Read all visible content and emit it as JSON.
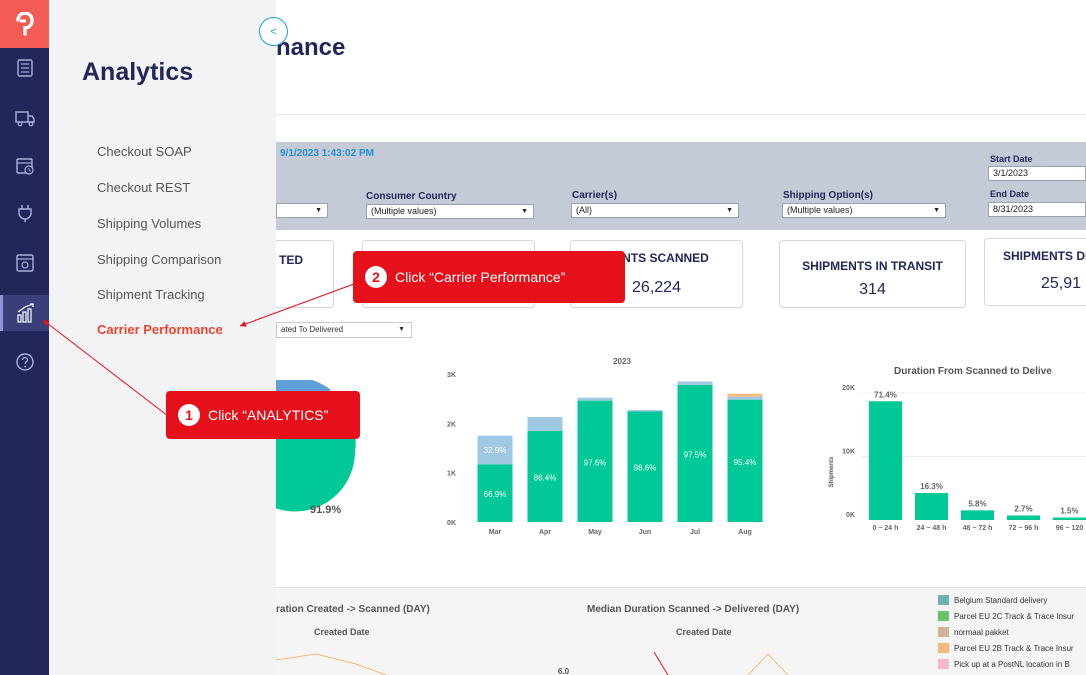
{
  "flyout": {
    "title": "Analytics",
    "items": [
      {
        "label": "Checkout SOAP"
      },
      {
        "label": "Checkout REST"
      },
      {
        "label": "Shipping Volumes"
      },
      {
        "label": "Shipping Comparison"
      },
      {
        "label": "Shipment Tracking"
      },
      {
        "label": "Carrier Performance"
      }
    ],
    "active_index": 5
  },
  "page": {
    "title_partial": "nance",
    "collapse_glyph": "<"
  },
  "filters": {
    "timestamp": "9/1/2023 1:43:02 PM",
    "consumer_country": {
      "label": "Consumer Country",
      "value": "(Multiple values)"
    },
    "carriers": {
      "label": "Carrier(s)",
      "value": "(All)"
    },
    "shipping_option": {
      "label": "Shipping Option(s)",
      "value": "(Multiple values)"
    },
    "start_date": {
      "label": "Start Date",
      "value": "3/1/2023"
    },
    "end_date": {
      "label": "End Date",
      "value": "8/31/2023"
    }
  },
  "kpis": [
    {
      "title": "TED",
      "value": ""
    },
    {
      "title": "MENTS SCANNED",
      "value": "26,224"
    },
    {
      "title": "SHIPMENTS IN TRANSIT",
      "value": "314"
    },
    {
      "title": "SHIPMENTS DE",
      "value": "25,91"
    }
  ],
  "duration_dropdown": {
    "value": "ated To Delivered"
  },
  "pie": {
    "label": "91.9%"
  },
  "chart_data": [
    {
      "type": "bar",
      "title": "2023",
      "categories": [
        "Mar",
        "Apr",
        "May",
        "Jun",
        "Jul",
        "Aug"
      ],
      "yticks": [
        "0K",
        "1K",
        "2K",
        "3K"
      ],
      "ylim": [
        0,
        3000
      ],
      "series": [
        {
          "values": [
            1170,
            1850,
            2460,
            2240,
            2780,
            2480
          ]
        },
        {
          "values": [
            580,
            280,
            60,
            30,
            70,
            60
          ]
        },
        {
          "values": [
            0,
            0,
            0,
            0,
            0,
            60
          ]
        }
      ],
      "labels": [
        "66.9%",
        "86.4%",
        "97.6%",
        "98.6%",
        "97.5%",
        "95.4%"
      ],
      "extra_label": "32.9%",
      "colors": [
        "#00c896",
        "#9fc8e3",
        "#f5b97a"
      ]
    },
    {
      "type": "bar",
      "title": "Duration From Scanned to Delive",
      "ylabel": "Shipments",
      "categories": [
        "0 ~ 24 h",
        "24 ~ 48 h",
        "48 ~ 72 h",
        "72 ~ 96 h",
        "96 ~ 120"
      ],
      "values": [
        18700,
        4250,
        1520,
        710,
        390
      ],
      "labels": [
        "71.4%",
        "16.3%",
        "5.8%",
        "2.7%",
        "1.5%"
      ],
      "yticks": [
        "0K",
        "10K",
        "20K"
      ],
      "ylim": [
        0,
        20000
      ],
      "color": "#00c896"
    }
  ],
  "lower": {
    "title_left": "ration Created -> Scanned (DAY)",
    "sub_left": "Created Date",
    "title_mid": "Median Duration Scanned -> Delivered (DAY)",
    "sub_mid": "Created Date",
    "ytick": "6.0",
    "legend": [
      {
        "label": "Belgium Standard delivery",
        "color": "#6bb5a8"
      },
      {
        "label": "Parcel EU 2C Track & Trace Insur",
        "color": "#66c26b"
      },
      {
        "label": "normaal pakket",
        "color": "#d2b39c"
      },
      {
        "label": "Parcel EU 2B Track & Trace Insur",
        "color": "#f5b97a"
      },
      {
        "label": "Pick up at a PostNL location in B",
        "color": "#f6b6cb"
      }
    ]
  },
  "callouts": [
    {
      "num": "1",
      "text": "Click “ANALYTICS”"
    },
    {
      "num": "2",
      "text": "Click “Carrier Performance”"
    }
  ],
  "colors": {
    "rail": "#22265a",
    "accent": "#e8472f",
    "green": "#00c896",
    "callout": "#e5101a"
  }
}
